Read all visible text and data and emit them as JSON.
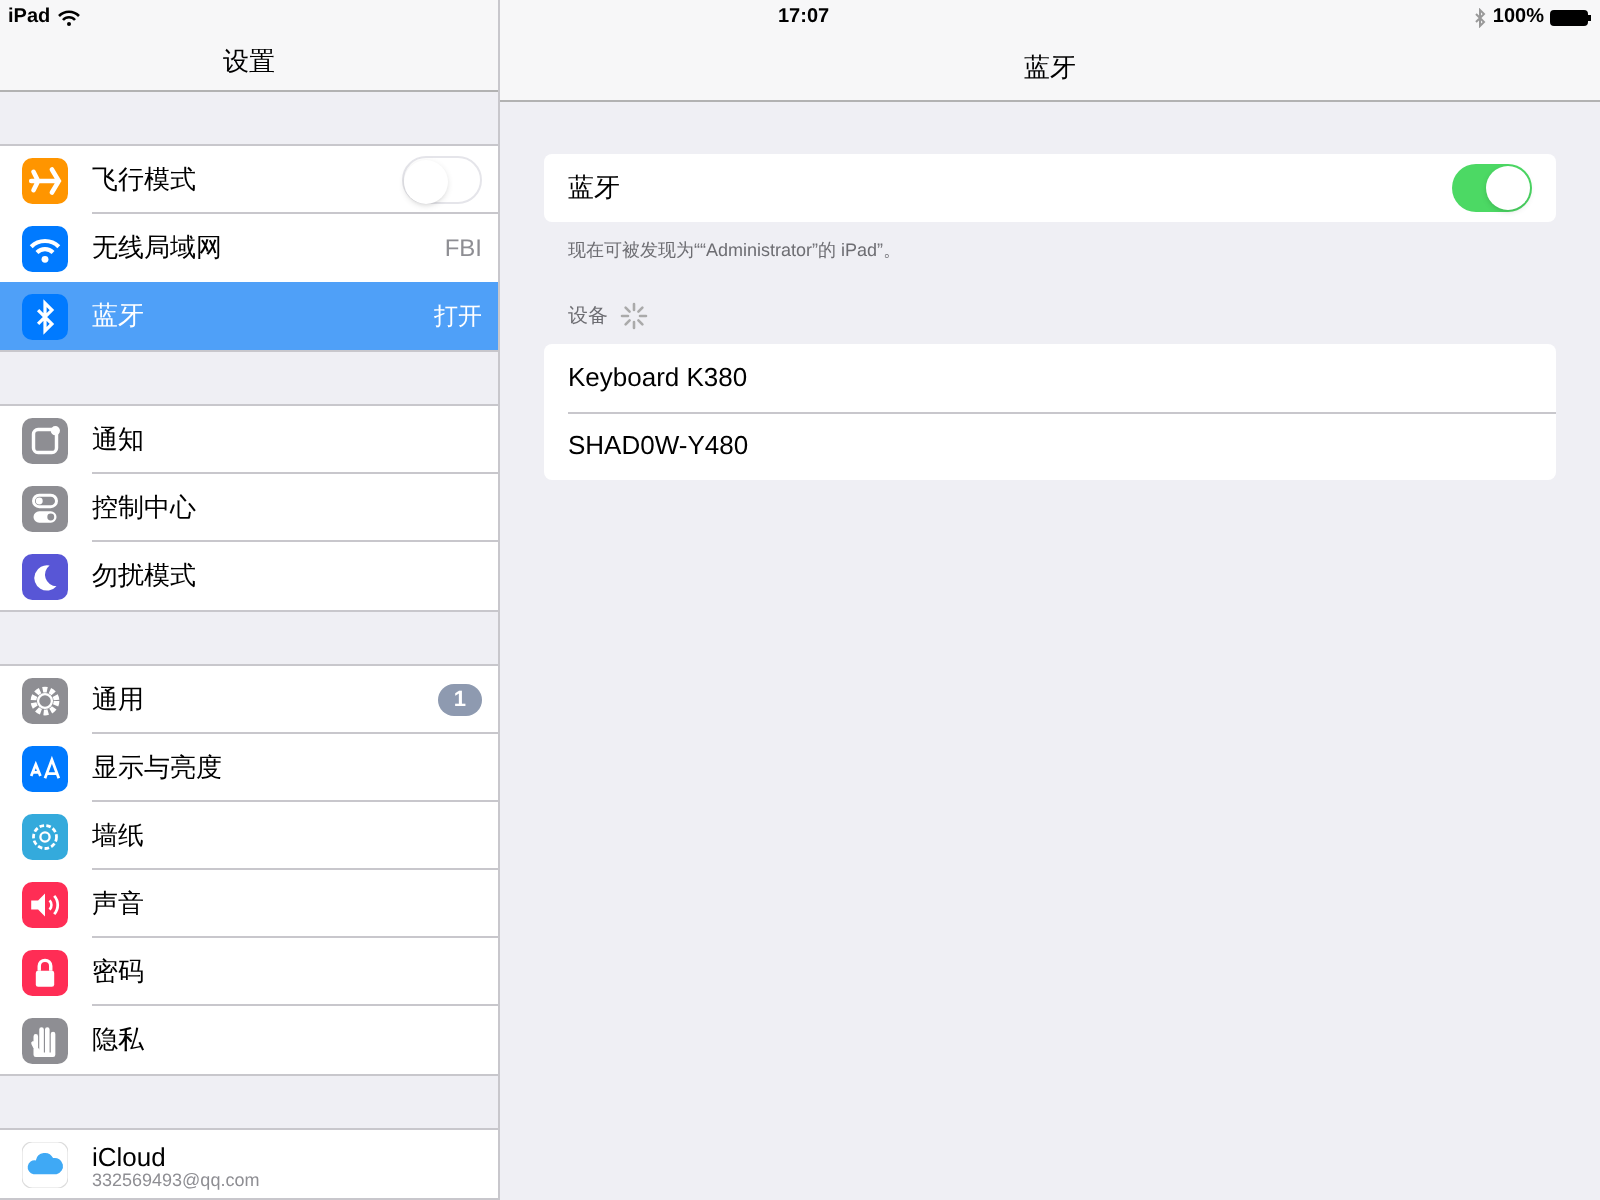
{
  "status_bar": {
    "device": "iPad",
    "time": "17:07",
    "battery": "100%"
  },
  "sidebar": {
    "title": "设置",
    "groups": [
      [
        {
          "label": "飞行模式",
          "kind": "toggle",
          "on": false,
          "selected": false
        },
        {
          "label": "无线局域网",
          "kind": "value",
          "value": "FBI",
          "selected": false
        },
        {
          "label": "蓝牙",
          "kind": "value",
          "value": "打开",
          "selected": true
        }
      ],
      [
        {
          "label": "通知",
          "kind": "plain",
          "selected": false
        },
        {
          "label": "控制中心",
          "kind": "plain",
          "selected": false
        },
        {
          "label": "勿扰模式",
          "kind": "plain",
          "selected": false
        }
      ],
      [
        {
          "label": "通用",
          "kind": "badge",
          "badge": "1",
          "selected": false
        },
        {
          "label": "显示与亮度",
          "kind": "plain",
          "selected": false
        },
        {
          "label": "墙纸",
          "kind": "plain",
          "selected": false
        },
        {
          "label": "声音",
          "kind": "plain",
          "selected": false
        },
        {
          "label": "密码",
          "kind": "plain",
          "selected": false
        },
        {
          "label": "隐私",
          "kind": "plain",
          "selected": false
        }
      ],
      [
        {
          "label": "iCloud",
          "kind": "account",
          "subtitle": "332569493@qq.com",
          "selected": false
        }
      ]
    ]
  },
  "detail": {
    "title": "蓝牙",
    "bluetooth": {
      "label": "蓝牙",
      "on": true
    },
    "footnote": "现在可被发现为““Administrator”的 iPad”。",
    "devices_header": "设备",
    "devices": [
      "Keyboard K380",
      "SHAD0W-Y480"
    ]
  }
}
